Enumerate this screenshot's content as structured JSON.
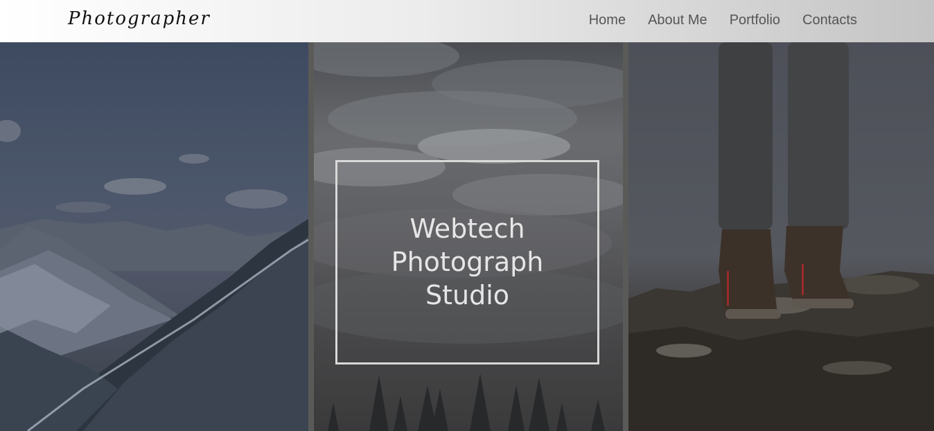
{
  "header": {
    "brand": "Photographer",
    "nav": [
      {
        "label": "Home"
      },
      {
        "label": "About Me"
      },
      {
        "label": "Portfolio"
      },
      {
        "label": "Contacts"
      }
    ]
  },
  "hero": {
    "title_lines": [
      "Webtech",
      "Photograph",
      "Studio"
    ]
  },
  "colors": {
    "title_text": "#e6e6e6",
    "frame_border": "#d9d9d9",
    "nav_text": "#555555",
    "brand_text": "#111111"
  }
}
